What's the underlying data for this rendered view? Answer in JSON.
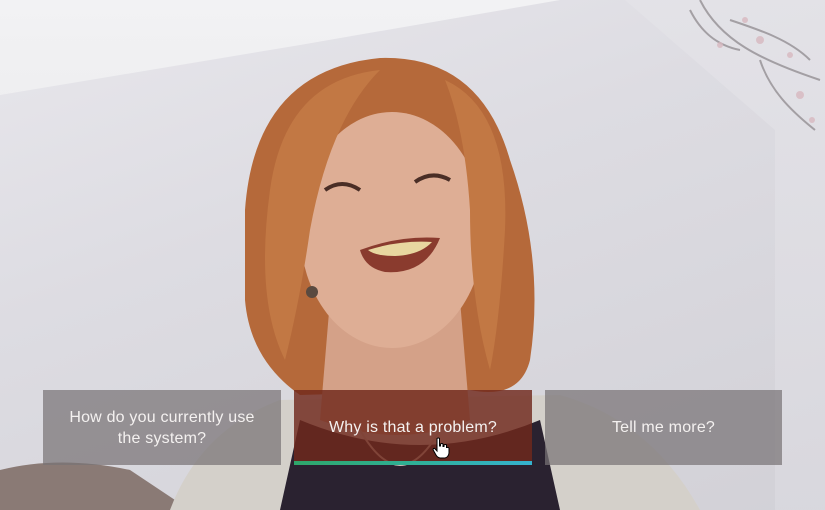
{
  "options": [
    {
      "label": "How do you currently use the system?"
    },
    {
      "label": "Why is that a problem?",
      "selected": true
    },
    {
      "label": "Tell me more?"
    }
  ],
  "progress": {
    "fraction": 1.0
  },
  "icons": {
    "cursor": "hand-pointer-icon"
  },
  "colors": {
    "selected_option_bg": "#70281c",
    "option_bg": "#78737a",
    "progress_start": "#2fa66a",
    "progress_end": "#35b2cf"
  }
}
